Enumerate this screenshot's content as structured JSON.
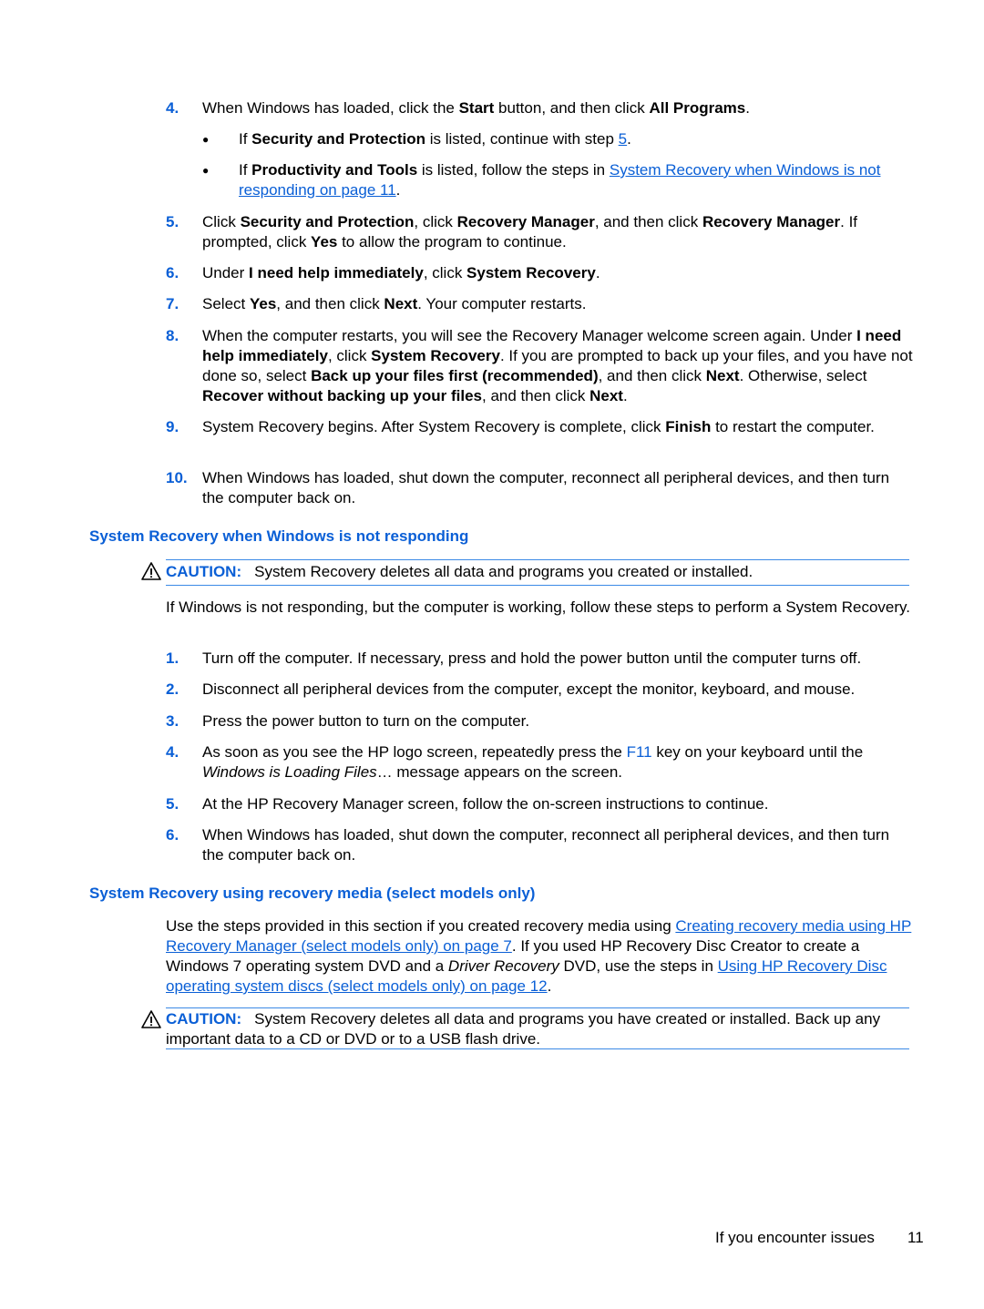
{
  "section1": {
    "step4": {
      "num": "4.",
      "t1": "When Windows has loaded, click the ",
      "b1": "Start",
      "t2": " button, and then click ",
      "b2": "All Programs",
      "t3": ".",
      "bullets": [
        {
          "dot": "●",
          "t1": "If ",
          "b1": "Security and Protection",
          "t2": " is listed, continue with step ",
          "link": "5",
          "t3": "."
        },
        {
          "dot": "●",
          "t1": "If ",
          "b1": "Productivity and Tools",
          "t2": " is listed, follow the steps in ",
          "link": "System Recovery when Windows is not responding on page 11",
          "t3": "."
        }
      ]
    },
    "step5": {
      "num": "5.",
      "t1": "Click ",
      "b1": "Security and Protection",
      "t2": ", click ",
      "b2": "Recovery Manager",
      "t3": ", and then click ",
      "b3": "Recovery Manager",
      "t4": ". If prompted, click ",
      "b4": "Yes",
      "t5": " to allow the program to continue."
    },
    "step6": {
      "num": "6.",
      "t1": "Under ",
      "b1": "I need help immediately",
      "t2": ", click ",
      "b2": "System Recovery",
      "t3": "."
    },
    "step7": {
      "num": "7.",
      "t1": "Select ",
      "b1": "Yes",
      "t2": ", and then click ",
      "b2": "Next",
      "t3": ". Your computer restarts."
    },
    "step8": {
      "num": "8.",
      "t1": "When the computer restarts, you will see the Recovery Manager welcome screen again. Under ",
      "b1": "I need help immediately",
      "t2": ", click ",
      "b2": "System Recovery",
      "t3": ". If you are prompted to back up your files, and you have not done so, select ",
      "b3": "Back up your files first (recommended)",
      "t4": ", and then click ",
      "b4": "Next",
      "t5": ". Otherwise, select ",
      "b5": "Recover without backing up your files",
      "t6": ", and then click ",
      "b6": "Next",
      "t7": "."
    },
    "step9": {
      "num": "9.",
      "t1": "System Recovery begins. After System Recovery is complete, click ",
      "b1": "Finish",
      "t2": " to restart the computer."
    },
    "step10": {
      "num": "10.",
      "t1": "When Windows has loaded, shut down the computer, reconnect all peripheral devices, and then turn the computer back on."
    }
  },
  "section2": {
    "heading": "System Recovery when Windows is not responding",
    "caution": {
      "label": "CAUTION:",
      "text": "System Recovery deletes all data and programs you created or installed."
    },
    "intro": "If Windows is not responding, but the computer is working, follow these steps to perform a System Recovery.",
    "steps": [
      {
        "num": "1.",
        "text": "Turn off the computer. If necessary, press and hold the power button until the computer turns off."
      },
      {
        "num": "2.",
        "text": "Disconnect all peripheral devices from the computer, except the monitor, keyboard, and mouse."
      },
      {
        "num": "3.",
        "text": "Press the power button to turn on the computer."
      },
      {
        "num": "4.",
        "t1": "As soon as you see the HP logo screen, repeatedly press the ",
        "key": "F11",
        "t2": " key on your keyboard until the ",
        "i1": "Windows is Loading Files",
        "t3": "… message appears on the screen."
      },
      {
        "num": "5.",
        "text": "At the HP Recovery Manager screen, follow the on-screen instructions to continue."
      },
      {
        "num": "6.",
        "text": "When Windows has loaded, shut down the computer, reconnect all peripheral devices, and then turn the computer back on."
      }
    ]
  },
  "section3": {
    "heading": "System Recovery using recovery media (select models only)",
    "intro": {
      "t1": "Use the steps provided in this section if you created recovery media using ",
      "link1": "Creating recovery media using HP Recovery Manager (select models only) on page 7",
      "t2": ". If you used HP Recovery Disc Creator to create a Windows 7 operating system DVD and a ",
      "i1": "Driver Recovery",
      "t3": " DVD, use the steps in ",
      "link2": "Using HP Recovery Disc operating system discs (select models only) on page 12",
      "t4": "."
    },
    "caution": {
      "label": "CAUTION:",
      "text": "System Recovery deletes all data and programs you have created or installed. Back up any important data to a CD or DVD or to a USB flash drive."
    }
  },
  "footer": {
    "section": "If you encounter issues",
    "page": "11"
  }
}
